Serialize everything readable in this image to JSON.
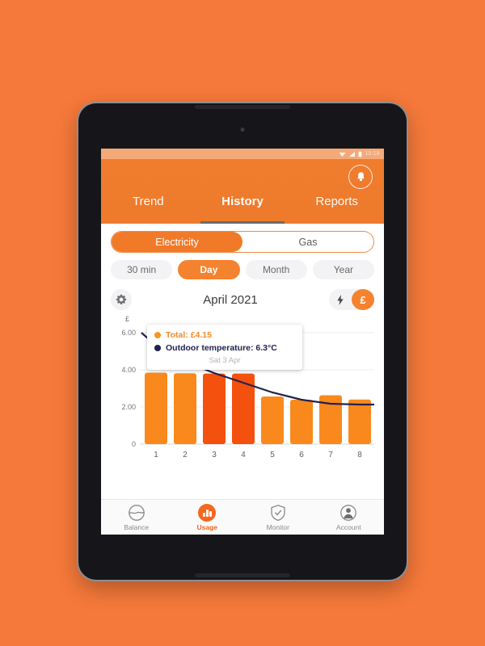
{
  "background_color": "#F5793A",
  "device": {
    "name": "tablet-frame",
    "bezel_color": "#16161a"
  },
  "statusbar": {
    "clock": "10:18",
    "icons": [
      "wifi-icon",
      "signal-icon",
      "battery-icon"
    ]
  },
  "header": {
    "bell_icon": "bell-icon",
    "tabs": [
      {
        "label": "Trend",
        "active": false
      },
      {
        "label": "History",
        "active": true
      },
      {
        "label": "Reports",
        "active": false
      }
    ]
  },
  "fuel_toggle": {
    "options": [
      {
        "label": "Electricity",
        "active": true
      },
      {
        "label": "Gas",
        "active": false
      }
    ]
  },
  "period_toggle": {
    "options": [
      {
        "label": "30 min",
        "active": false
      },
      {
        "label": "Day",
        "active": true
      },
      {
        "label": "Month",
        "active": false
      },
      {
        "label": "Year",
        "active": false
      }
    ]
  },
  "date_row": {
    "gear_icon": "gear-icon",
    "date_label": "April 2021",
    "unit_toggle": {
      "kwh_icon": "lightning-bolt-icon",
      "currency_symbol": "£",
      "selected": "currency"
    }
  },
  "tooltip": {
    "total_label": "Total: £4.15",
    "temperature_label": "Outdoor temperature: 6.3°C",
    "date_label": "Sat 3 Apr",
    "total_color": "#F08A2B",
    "temperature_color": "#22224e"
  },
  "bottom_nav": [
    {
      "label": "Balance",
      "icon": "balance-circle-icon",
      "active": false
    },
    {
      "label": "Usage",
      "icon": "usage-bars-icon",
      "active": true
    },
    {
      "label": "Monitor",
      "icon": "shield-check-icon",
      "active": false
    },
    {
      "label": "Account",
      "icon": "person-icon",
      "active": false
    }
  ],
  "chart_data": {
    "type": "bar",
    "title": "April 2021",
    "xlabel": "",
    "ylabel": "£",
    "ylim": [
      0,
      6.8
    ],
    "yticks": [
      0,
      2.0,
      4.0,
      6.0
    ],
    "ytick_labels": [
      "0",
      "2.00",
      "4.00",
      "6.00"
    ],
    "grid": true,
    "categories": [
      "1",
      "2",
      "3",
      "4",
      "5",
      "6",
      "7",
      "8"
    ],
    "series": [
      {
        "name": "Total",
        "type": "bar",
        "unit": "£",
        "values": [
          3.85,
          3.82,
          3.8,
          3.8,
          2.55,
          2.38,
          2.62,
          2.4
        ],
        "colors": [
          "#F9891C",
          "#F9891C",
          "#F4500E",
          "#F4500E",
          "#F9891C",
          "#F9891C",
          "#F9891C",
          "#F9891C"
        ],
        "highlighted": [
          "3",
          "4"
        ]
      },
      {
        "name": "Outdoor temperature",
        "type": "line",
        "unit": "°C",
        "color": "#22224e",
        "values_scaled": [
          6.0,
          5.1,
          4.2,
          3.6,
          3.1,
          2.55,
          2.15,
          2.02,
          2.0
        ]
      }
    ],
    "legend_position": "tooltip",
    "annotations": [
      {
        "text": "Total: £4.15",
        "color": "#F08A2B"
      },
      {
        "text": "Outdoor temperature: 6.3°C",
        "color": "#22224e"
      },
      {
        "text": "Sat 3 Apr",
        "color": "#b3b3b8"
      }
    ]
  }
}
